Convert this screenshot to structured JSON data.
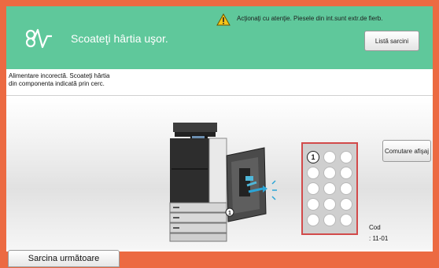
{
  "header": {
    "title": "Scoateţi hârtia uşor.",
    "icon": "paper-jam-wave-icon",
    "warning_icon": "warning-triangle-icon",
    "warning": "Acţionaţi cu atenţie. Piesele din int.sunt extr.de fierb.",
    "job_list_label": "Listă sarcini"
  },
  "message": {
    "line1": "Alimentare incorectă. Scoateţi hârtia",
    "line2": "din componenta indicată prin cerc."
  },
  "illustration": {
    "machine_marker": "1",
    "panel_marker": "1"
  },
  "switch_display_label": "Comutare afişaj",
  "code": {
    "label": "Cod",
    "value": ": 11-01"
  },
  "footer": {
    "next_job_label": "Sarcina următoare"
  },
  "colors": {
    "accent_orange": "#ec6a42",
    "header_green": "#5fc89b",
    "panel_highlight": "#d24a4a"
  }
}
